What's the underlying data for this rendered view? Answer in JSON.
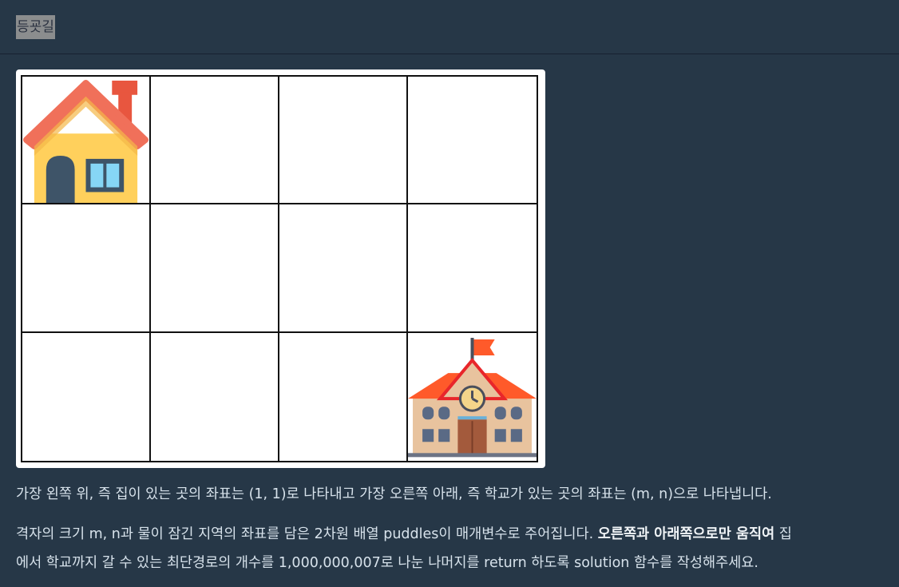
{
  "header": {
    "tab_title": "등굣길"
  },
  "figure": {
    "rows": 3,
    "cols": 4,
    "home_icon": "house-icon",
    "school_icon": "school-icon"
  },
  "description": {
    "p1": "가장 왼쪽 위, 즉 집이 있는 곳의 좌표는 (1, 1)로 나타내고 가장 오른쪽 아래, 즉 학교가 있는 곳의 좌표는 (m, n)으로 나타냅니다.",
    "p2_a": "격자의 크기 m, n과 물이 잠긴 지역의 좌표를 담은 2차원 배열 puddles이 매개변수로 주어집니다. ",
    "p2_bold": "오른쪽과 아래쪽으로만 움직여",
    "p2_b": " 집",
    "p2_c": "에서 학교까지 갈 수 있는 최단경로의 개수를 1,000,000,007로 나눈 나머지를 return 하도록 solution 함수를 작성해주세요."
  }
}
